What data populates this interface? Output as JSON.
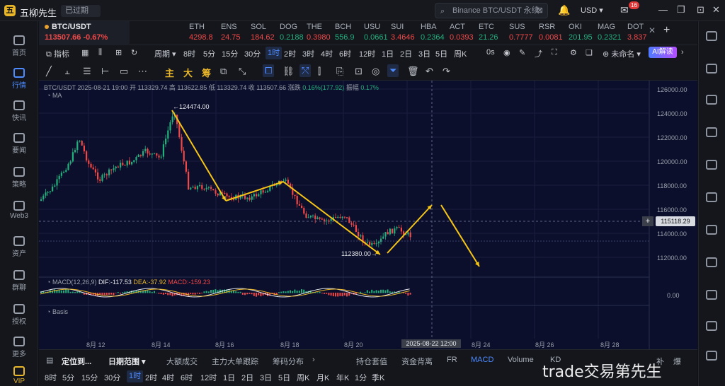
{
  "app": {
    "logo_char": "五",
    "name": "五柳先生",
    "status_badge": "已过期"
  },
  "search": {
    "placeholder": "Binance BTC/USDT 永续"
  },
  "header": {
    "currency": "USD",
    "mail_badge": "16"
  },
  "sidebar": {
    "items": [
      {
        "label": "首页"
      },
      {
        "label": "行情"
      },
      {
        "label": "快讯"
      },
      {
        "label": "要闻"
      },
      {
        "label": "策略"
      },
      {
        "label": "Web3"
      },
      {
        "label": "资产"
      },
      {
        "label": "群聊"
      },
      {
        "label": "授权"
      },
      {
        "label": "更多"
      },
      {
        "label": "VIP"
      }
    ]
  },
  "tickers": [
    {
      "symbol": "BTC/USDT",
      "price": "113507.66",
      "change": "-0.67%"
    },
    {
      "symbol": "ETH",
      "price": "4298.8",
      "trend": "down"
    },
    {
      "symbol": "ENS",
      "price": "24.75",
      "trend": "down"
    },
    {
      "symbol": "SOL",
      "price": "184.62",
      "trend": "down"
    },
    {
      "symbol": "DOG",
      "price": "0.2188",
      "trend": "up"
    },
    {
      "symbol": "THE",
      "price": "0.3980",
      "trend": "down"
    },
    {
      "symbol": "BCH",
      "price": "556.9",
      "trend": "up"
    },
    {
      "symbol": "USU",
      "price": "0.0661",
      "trend": "up"
    },
    {
      "symbol": "SUI",
      "price": "3.4646",
      "trend": "down"
    },
    {
      "symbol": "HBA",
      "price": "0.2364",
      "trend": "up"
    },
    {
      "symbol": "ACT",
      "price": "0.0393",
      "trend": "down"
    },
    {
      "symbol": "ETC",
      "price": "21.26",
      "trend": "up"
    },
    {
      "symbol": "SUS",
      "price": "0.7777",
      "trend": "down"
    },
    {
      "symbol": "RSR",
      "price": "0.0081",
      "trend": "down"
    },
    {
      "symbol": "OKI",
      "price": "201.95",
      "trend": "up"
    },
    {
      "symbol": "MAG",
      "price": "0.2321",
      "trend": "up"
    },
    {
      "symbol": "DOT",
      "price": "3.837",
      "trend": "down"
    }
  ],
  "toolbar": {
    "indicators": "指标",
    "period": "周期",
    "unnamed": "未命名",
    "ai_button": "AI解读",
    "zero_s": "0s",
    "timeframes": [
      "8时",
      "5分",
      "15分",
      "30分",
      "1时",
      "2时",
      "3时",
      "4时",
      "6时",
      "12时",
      "1日",
      "2日",
      "3日",
      "5日",
      "周K"
    ],
    "selected_timeframe": "1时",
    "draw_labels": [
      "主",
      "大",
      "筹"
    ]
  },
  "chart_info": {
    "symbol": "BTC/USDT",
    "datetime": "2025-08-21 19:00",
    "open_label": "开",
    "open": "113329.74",
    "high_label": "高",
    "high": "113622.85",
    "low_label": "低",
    "low": "113329.74",
    "close_label": "收",
    "close": "113507.66",
    "change_label": "涨跌",
    "change": "0.16%(177.92)",
    "amp_label": "振幅",
    "amplitude": "0.17%",
    "ma_label": "MA",
    "macd_label": "MACD(12,26,9)",
    "dif": "DIF:-117.53",
    "dea": "DEA:-37.92",
    "macd": "MACD:-159.23",
    "macd_zero": "0.00",
    "basis_label": "Basis"
  },
  "price_axis": [
    "126000.00",
    "124000.00",
    "122000.00",
    "120000.00",
    "118000.00",
    "116000.00",
    "114000.00",
    "112000.00"
  ],
  "current_price": "115118.29",
  "annotations": {
    "high": "124474.00",
    "low": "112380.00"
  },
  "time_axis": [
    "8月 12",
    "8月 14",
    "8月 16",
    "8月 18",
    "8月 20",
    "8月 24",
    "8月 26",
    "8月 28"
  ],
  "cursor_time": "2025-08-22 12:00",
  "bottom_tabs": [
    "定位到...",
    "日期范围",
    "大额成交",
    "主力大单跟踪",
    "筹码分布",
    "持仓套值",
    "资金背离",
    "FR",
    "MACD",
    "Volume",
    "KD"
  ],
  "bottom_tabs_right": [
    "补",
    "爆"
  ],
  "bottom_timeframes": [
    "8时",
    "5分",
    "15分",
    "30分",
    "1时",
    "2时",
    "4时",
    "6时",
    "12时",
    "1日",
    "2日",
    "3日",
    "5日",
    "周K",
    "月K",
    "年K",
    "1分",
    "季K"
  ],
  "watermark": "trade交易第先生",
  "colors": {
    "up": "#22b07d",
    "down": "#f04848",
    "accent": "#4e8bff",
    "arrow": "#f5c518",
    "chart_bg": "#0c0f2b"
  }
}
